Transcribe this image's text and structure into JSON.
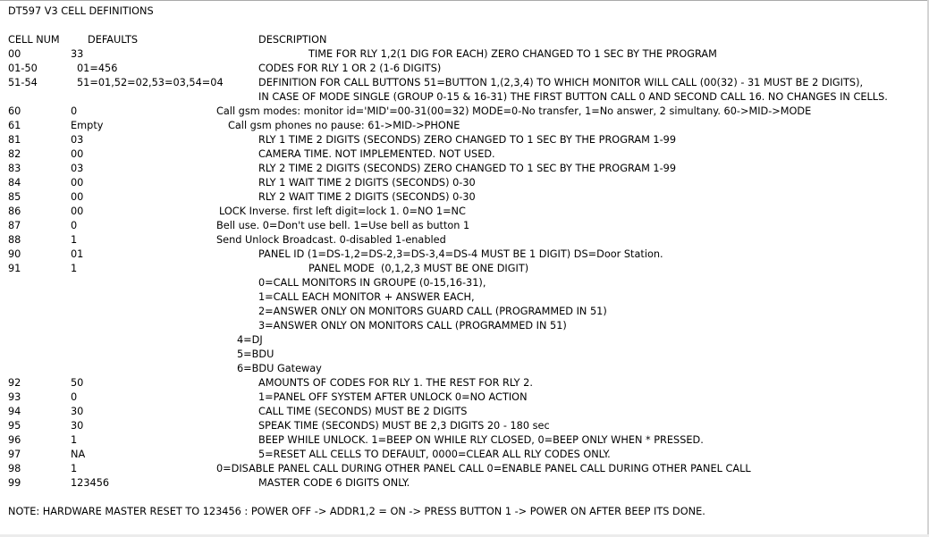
{
  "document": {
    "title": "DT597 V3 CELL DEFINITIONS",
    "headers": {
      "cell_num": "CELL NUM",
      "defaults": "DEFAULTS",
      "description": "DESCRIPTION"
    },
    "note": "NOTE: HARDWARE MASTER RESET TO 123456 : POWER OFF -> ADDR1,2 = ON -> PRESS BUTTON 1 -> POWER ON AFTER BEEP ITS DONE."
  },
  "rows": [
    {
      "cell": "00",
      "default": "33",
      "desc": "TIME FOR RLY 1,2(1 DIG FOR EACH) ZERO CHANGED TO 1 SEC BY THE PROGRAM"
    },
    {
      "cell": "01-50",
      "default": "01=456",
      "desc": "CODES FOR RLY 1 OR 2 (1-6 DIGITS)"
    },
    {
      "cell": "51-54",
      "default": "51=01,52=02,53=03,54=04",
      "desc": "DEFINITION FOR CALL BUTTONS 51=BUTTON 1,(2,3,4) TO WHICH MONITOR WILL CALL (00(32) - 31 MUST BE 2 DIGITS),"
    },
    {
      "cell": "",
      "default": "",
      "desc": "IN CASE OF MODE SINGLE (GROUP 0-15 & 16-31) THE FIRST BUTTON CALL 0 AND SECOND CALL 16. NO CHANGES IN CELLS."
    },
    {
      "cell": "60",
      "default": "0",
      "desc": "Call gsm modes: monitor id='MID'=00-31(00=32) MODE=0-No transfer, 1=No answer, 2 simultany. 60->MID->MODE"
    },
    {
      "cell": "61",
      "default": "Empty",
      "desc": "Call gsm phones no pause: 61->MID->PHONE"
    },
    {
      "cell": "81",
      "default": "03",
      "desc": "RLY 1 TIME 2 DIGITS (SECONDS) ZERO CHANGED TO 1 SEC BY THE PROGRAM 1-99"
    },
    {
      "cell": "82",
      "default": "00",
      "desc": "CAMERA TIME. NOT IMPLEMENTED. NOT USED."
    },
    {
      "cell": "83",
      "default": "03",
      "desc": "RLY 2 TIME 2 DIGITS (SECONDS) ZERO CHANGED TO 1 SEC BY THE PROGRAM 1-99"
    },
    {
      "cell": "84",
      "default": "00",
      "desc": "RLY 1 WAIT TIME 2 DIGITS (SECONDS) 0-30"
    },
    {
      "cell": "85",
      "default": "00",
      "desc": "RLY 2 WAIT TIME 2 DIGITS (SECONDS) 0-30"
    },
    {
      "cell": "86",
      "default": "00",
      "desc": "LOCK Inverse. first left digit=lock 1. 0=NO 1=NC"
    },
    {
      "cell": "87",
      "default": "0",
      "desc": "Bell use. 0=Don't use bell. 1=Use bell as button 1"
    },
    {
      "cell": "88",
      "default": "1",
      "desc": "Send Unlock Broadcast. 0-disabled 1-enabled"
    },
    {
      "cell": "90",
      "default": "01",
      "desc": "PANEL ID (1=DS-1,2=DS-2,3=DS-3,4=DS-4 MUST BE 1 DIGIT) DS=Door Station."
    },
    {
      "cell": "91",
      "default": "1",
      "desc": "PANEL MODE  (0,1,2,3 MUST BE ONE DIGIT)"
    },
    {
      "cell": "",
      "default": "",
      "desc": "0=CALL MONITORS IN GROUPE (0-15,16-31),"
    },
    {
      "cell": "",
      "default": "",
      "desc": "1=CALL EACH MONITOR + ANSWER EACH,"
    },
    {
      "cell": "",
      "default": "",
      "desc": "2=ANSWER ONLY ON MONITORS GUARD CALL (PROGRAMMED IN 51)"
    },
    {
      "cell": "",
      "default": "",
      "desc": "3=ANSWER ONLY ON MONITORS CALL (PROGRAMMED IN 51)"
    },
    {
      "cell": "",
      "default": "",
      "desc": "4=DJ"
    },
    {
      "cell": "",
      "default": "",
      "desc": "5=BDU"
    },
    {
      "cell": "",
      "default": "",
      "desc": "6=BDU Gateway"
    },
    {
      "cell": "92",
      "default": "50",
      "desc": "AMOUNTS OF CODES FOR RLY 1. THE REST FOR RLY 2."
    },
    {
      "cell": "93",
      "default": "0",
      "desc": "1=PANEL OFF SYSTEM AFTER UNLOCK 0=NO ACTION"
    },
    {
      "cell": "94",
      "default": "30",
      "desc": "CALL TIME (SECONDS) MUST BE 2 DIGITS"
    },
    {
      "cell": "95",
      "default": "30",
      "desc": "SPEAK TIME (SECONDS) MUST BE 2,3 DIGITS 20 - 180 sec"
    },
    {
      "cell": "96",
      "default": "1",
      "desc": "BEEP WHILE UNLOCK. 1=BEEP ON WHILE RLY CLOSED, 0=BEEP ONLY WHEN * PRESSED."
    },
    {
      "cell": "97",
      "default": "NA",
      "desc": "5=RESET ALL CELLS TO DEFAULT, 0000=CLEAR ALL RLY CODES ONLY."
    },
    {
      "cell": "98",
      "default": "1",
      "desc": "0=DISABLE PANEL CALL DURING OTHER PANEL CALL 0=ENABLE PANEL CALL DURING OTHER PANEL CALL"
    },
    {
      "cell": "99",
      "default": "123456",
      "desc": "MASTER CODE 6 DIGITS ONLY."
    }
  ]
}
